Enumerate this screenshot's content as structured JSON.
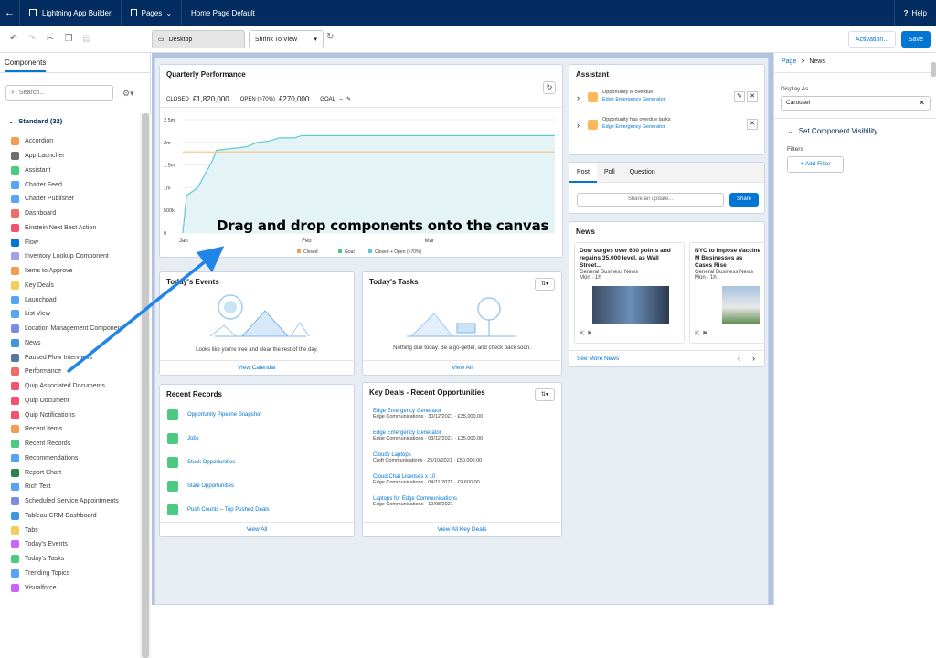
{
  "topbar": {
    "app_title": "Lightning App Builder",
    "pages_label": "Pages",
    "page_name": "Home Page Default",
    "help_label": "Help"
  },
  "toolbar": {
    "device": "Desktop",
    "view_mode": "Shrink To View",
    "activation": "Activation...",
    "save": "Save"
  },
  "left": {
    "tab": "Components",
    "search_placeholder": "Search...",
    "standard_header": "Standard (32)",
    "items": [
      {
        "label": "Accordion",
        "color": "#f59d4e"
      },
      {
        "label": "App Launcher",
        "color": "#706e6b"
      },
      {
        "label": "Assistant",
        "color": "#4bca81"
      },
      {
        "label": "Chatter Feed",
        "color": "#54a5f7"
      },
      {
        "label": "Chatter Publisher",
        "color": "#54a5f7"
      },
      {
        "label": "Dashboard",
        "color": "#ef6e64"
      },
      {
        "label": "Einstein Next Best Action",
        "color": "#f2536e"
      },
      {
        "label": "Flow",
        "color": "#0176d3"
      },
      {
        "label": "Inventory Lookup Component",
        "color": "#9ea3e8"
      },
      {
        "label": "Items to Approve",
        "color": "#f59d4e"
      },
      {
        "label": "Key Deals",
        "color": "#f2cf5b"
      },
      {
        "label": "Launchpad",
        "color": "#54a5f7"
      },
      {
        "label": "List View",
        "color": "#54a5f7"
      },
      {
        "label": "Location Management Component",
        "color": "#7e8be4"
      },
      {
        "label": "News",
        "color": "#3c97dd"
      },
      {
        "label": "Paused Flow Interviews",
        "color": "#5876a3"
      },
      {
        "label": "Performance",
        "color": "#ef6e64"
      },
      {
        "label": "Quip Associated Documents",
        "color": "#f2536e"
      },
      {
        "label": "Quip Document",
        "color": "#f2536e"
      },
      {
        "label": "Quip Notifications",
        "color": "#f2536e"
      },
      {
        "label": "Recent Items",
        "color": "#f59d4e"
      },
      {
        "label": "Recent Records",
        "color": "#4bca81"
      },
      {
        "label": "Recommendations",
        "color": "#54a5f7"
      },
      {
        "label": "Report Chart",
        "color": "#2e844a"
      },
      {
        "label": "Rich Text",
        "color": "#54a5f7"
      },
      {
        "label": "Scheduled Service Appointments",
        "color": "#7e8be4"
      },
      {
        "label": "Tableau CRM Dashboard",
        "color": "#3c97dd"
      },
      {
        "label": "Tabs",
        "color": "#f2cf5b"
      },
      {
        "label": "Today's Events",
        "color": "#cb65ff"
      },
      {
        "label": "Today's Tasks",
        "color": "#4bca81"
      },
      {
        "label": "Trending Topics",
        "color": "#54a5f7"
      },
      {
        "label": "Visualforce",
        "color": "#cb65ff"
      }
    ]
  },
  "performance": {
    "title": "Quarterly Performance",
    "closed_label": "CLOSED",
    "closed_value": "£1,820,000",
    "open_label": "OPEN (>70%)",
    "open_value": "£270,000",
    "goal_label": "GOAL",
    "goal_value": "--",
    "yticks": [
      "2.5m",
      "2m",
      "1.5m",
      "1m",
      "500k",
      "0"
    ],
    "xticks": [
      "Jan",
      "Feb",
      "Mar"
    ],
    "legend": [
      "Closed",
      "Goal",
      "Closed + Open (>70%)"
    ]
  },
  "overlay": {
    "text": "Drag and drop components onto the canvas"
  },
  "events": {
    "title": "Today's Events",
    "empty": "Looks like you're free and clear the rest of the day.",
    "footer": "View Calendar"
  },
  "tasks": {
    "title": "Today's Tasks",
    "empty": "Nothing due today. Be a go-getter, and check back soon.",
    "footer": "View All"
  },
  "recent": {
    "title": "Recent Records",
    "items": [
      "Opportunity Pipeline Snapshot",
      "Jobs",
      "Stuck Opportunities",
      "Stale Opportunities",
      "Push Counts – Top Pushed Deals"
    ],
    "footer": "View All"
  },
  "deals": {
    "title": "Key Deals - Recent Opportunities",
    "items": [
      {
        "name": "Edge Emergency Generator",
        "detail": "Edge Communications · 30/12/2021 · £35,000.00"
      },
      {
        "name": "Edge Emergency Generator",
        "detail": "Edge Communications · 03/12/2021 · £35,000.00"
      },
      {
        "name": "Cloudy Laptops",
        "detail": "Croft Communications · 25/10/2021 · £50,000.00"
      },
      {
        "name": "Cloud Chat Licenses x 10",
        "detail": "Edge Communications · 04/11/2021 · £9,600.00"
      },
      {
        "name": "Laptops for Edge Communications",
        "detail": "Edge Communications · 12/08/2021"
      }
    ],
    "footer": "View All Key Deals"
  },
  "assistant": {
    "title": "Assistant",
    "items": [
      {
        "note": "Opportunity is overdue",
        "link": "Edge Emergency Generator"
      },
      {
        "note": "Opportunity has overdue tasks",
        "link": "Edge Emergency Generator"
      }
    ]
  },
  "publisher": {
    "tabs": [
      "Post",
      "Poll",
      "Question"
    ],
    "placeholder": "Share an update...",
    "share": "Share"
  },
  "news": {
    "title": "News",
    "items": [
      {
        "headline": "Dow surges over 600 points and regains 35,000 level, as Wall Street...",
        "source": "General Business News",
        "age": "Mon · 1h"
      },
      {
        "headline": "NYC to Impose Vaccine M Businesses as Cases Rise",
        "source": "General Business News",
        "age": "Mon · 1h"
      }
    ],
    "footer": "See More News"
  },
  "right": {
    "crumb_page": "Page",
    "crumb_sep": ">",
    "crumb_news": "News",
    "display_as_label": "Display As",
    "display_as_value": "Carousel",
    "visibility": "Set Component Visibility",
    "filters_label": "Filters",
    "add_filter": "+ Add Filter"
  }
}
